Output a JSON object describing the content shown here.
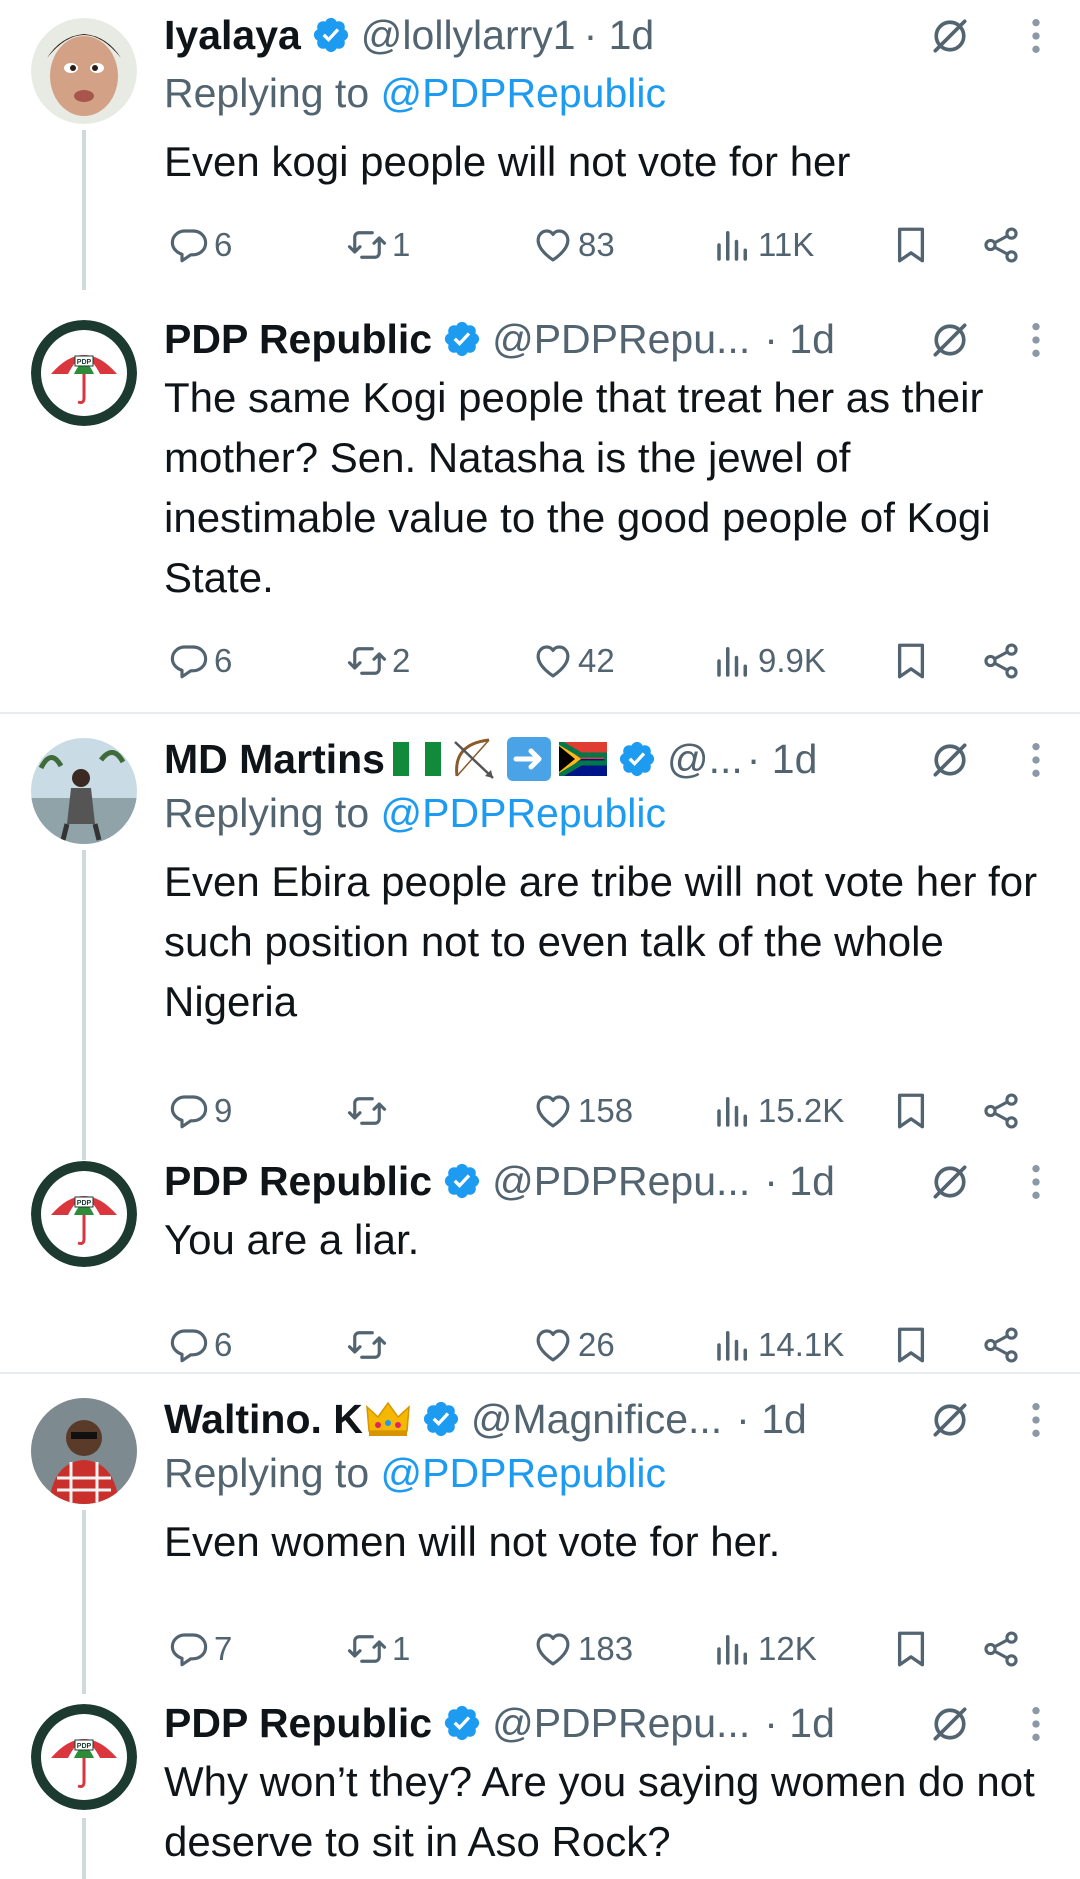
{
  "posts": [
    {
      "name": "Iyalaya",
      "handle": "@lollylarry1",
      "time": "· 1d",
      "replying_prefix": "Replying to ",
      "replying_to": "@PDPRepublic",
      "text": "Even kogi people will not vote for her",
      "replies": "6",
      "reposts": "1",
      "likes": "83",
      "views": "11K"
    },
    {
      "name": "PDP Republic",
      "handle": "@PDPRepu...",
      "time": " · 1d",
      "text": "The same Kogi people that treat her as their mother? Sen. Natasha is the jewel of inestimable value to the good people of Kogi State.",
      "replies": "6",
      "reposts": "2",
      "likes": "42",
      "views": "9.9K"
    },
    {
      "name": "MD Martins",
      "handle": "@...",
      "time": " · 1d",
      "replying_prefix": "Replying to ",
      "replying_to": "@PDPRepublic",
      "text": "Even Ebira people are tribe will not vote her for such position not to even talk of the whole Nigeria",
      "replies": "9",
      "reposts": "",
      "likes": "158",
      "views": "15.2K"
    },
    {
      "name": "PDP Republic",
      "handle": "@PDPRepu...",
      "time": " · 1d",
      "text": "You are a liar.",
      "replies": "6",
      "reposts": "",
      "likes": "26",
      "views": "14.1K"
    },
    {
      "name": "Waltino. K",
      "handle": "@Magnifice...",
      "time": " · 1d",
      "replying_prefix": "Replying to ",
      "replying_to": "@PDPRepublic",
      "text": "Even women will not vote for her.",
      "replies": "7",
      "reposts": "1",
      "likes": "183",
      "views": "12K"
    },
    {
      "name": "PDP Republic",
      "handle": "@PDPRepu...",
      "time": " · 1d",
      "text": "Why won’t they? Are you saying women do not deserve to sit in Aso Rock?"
    }
  ],
  "icons": {
    "verified": "verified-badge-icon",
    "grok": "grok-icon",
    "more": "more-icon",
    "reply": "reply-icon",
    "repost": "repost-icon",
    "like": "heart-icon",
    "views": "views-icon",
    "bookmark": "bookmark-icon",
    "share": "share-icon"
  },
  "colors": {
    "verified": "#1d9bf0",
    "link": "#1d9bf0",
    "secondary": "#536471",
    "text": "#0f1419"
  }
}
